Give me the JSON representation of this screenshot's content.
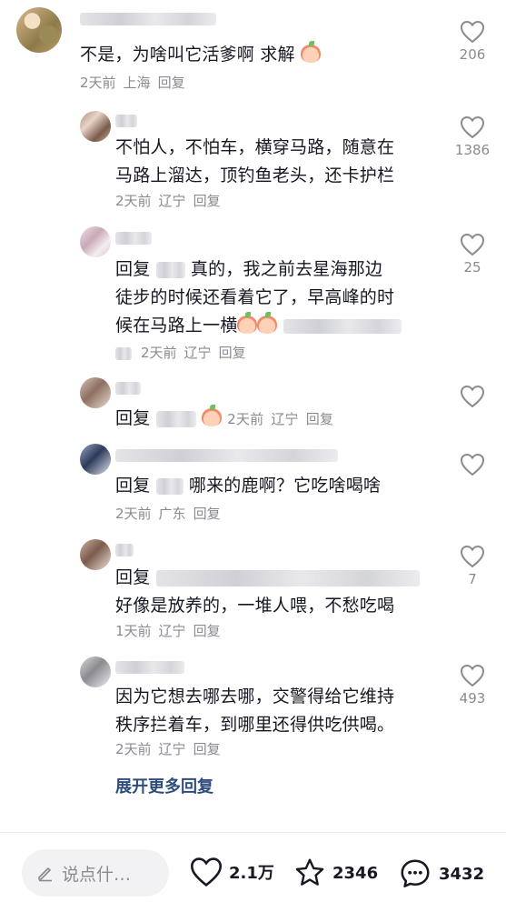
{
  "comments": [
    {
      "text": "不是，为啥叫它活爹啊 求解",
      "time": "2天前",
      "location": "上海",
      "reply_label": "回复",
      "likes": "206"
    },
    {
      "text_line1": "不怕人，不怕车，横穿马路，随意在",
      "text_line2": "马路上溜达，顶钓鱼老头，还卡护栏",
      "time": "2天前",
      "location": "辽宁",
      "reply_label": "回复",
      "likes": "1386"
    },
    {
      "prefix": "回复",
      "text_line1_after": "真的，我之前去星海那边",
      "text_line2": "徒步的时候还看着它了，早高峰的时",
      "text_line3": "候在马路上一横",
      "time": "2天前",
      "location": "辽宁",
      "reply_label": "回复",
      "likes": "25"
    },
    {
      "prefix": "回复",
      "time": "2天前",
      "location": "辽宁",
      "reply_label": "回复",
      "likes": ""
    },
    {
      "prefix": "回复",
      "text_after": "哪来的鹿啊？它吃啥喝啥",
      "time": "2天前",
      "location": "广东",
      "reply_label": "回复",
      "likes": ""
    },
    {
      "prefix": "回复",
      "text_line2": "好像是放养的，一堆人喂，不愁吃喝",
      "time": "1天前",
      "location": "辽宁",
      "reply_label": "回复",
      "likes": "7"
    },
    {
      "text_line1": "因为它想去哪去哪，交警得给它维持",
      "text_line2": "秩序拦着车，到哪里还得供吃供喝。",
      "time": "2天前",
      "location": "辽宁",
      "reply_label": "回复",
      "likes": "493"
    }
  ],
  "expand_replies": "展开更多回复",
  "bottom": {
    "input_placeholder": "说点什…",
    "like_count": "2.1万",
    "favorite_count": "2346",
    "comment_count": "3432"
  },
  "icons": {
    "like": "heart-outline-icon",
    "favorite": "star-outline-icon",
    "comment": "chat-bubble-icon",
    "edit": "pencil-icon",
    "emoji": "peach-face-emoji"
  }
}
